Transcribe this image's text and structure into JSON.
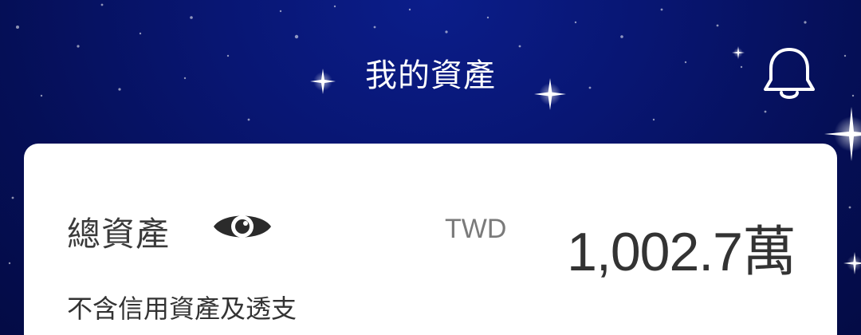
{
  "header": {
    "title": "我的資產",
    "notification_icon": "bell-icon"
  },
  "card": {
    "total_label": "總資產",
    "visibility_icon": "eye-icon",
    "currency": "TWD",
    "amount": "1,002.7萬",
    "note": "不含信用資產及透支"
  },
  "colors": {
    "header_background": "#081673",
    "card_background": "#ffffff",
    "title_text": "#ffffff",
    "amount_text": "#333333",
    "currency_text": "#7a7a7a"
  }
}
